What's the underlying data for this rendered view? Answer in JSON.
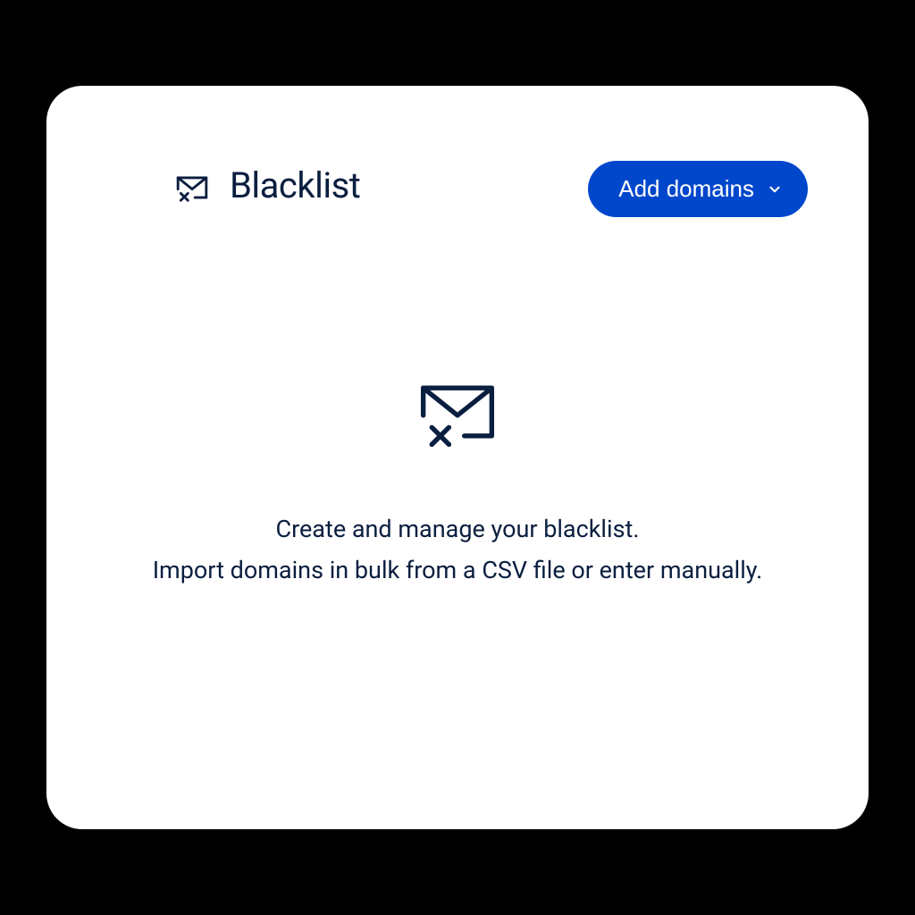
{
  "header": {
    "title": "Blacklist",
    "button_label": "Add domains"
  },
  "empty_state": {
    "line1": "Create and manage your blacklist.",
    "line2": "Import domains in bulk from a CSV file or enter manually."
  }
}
